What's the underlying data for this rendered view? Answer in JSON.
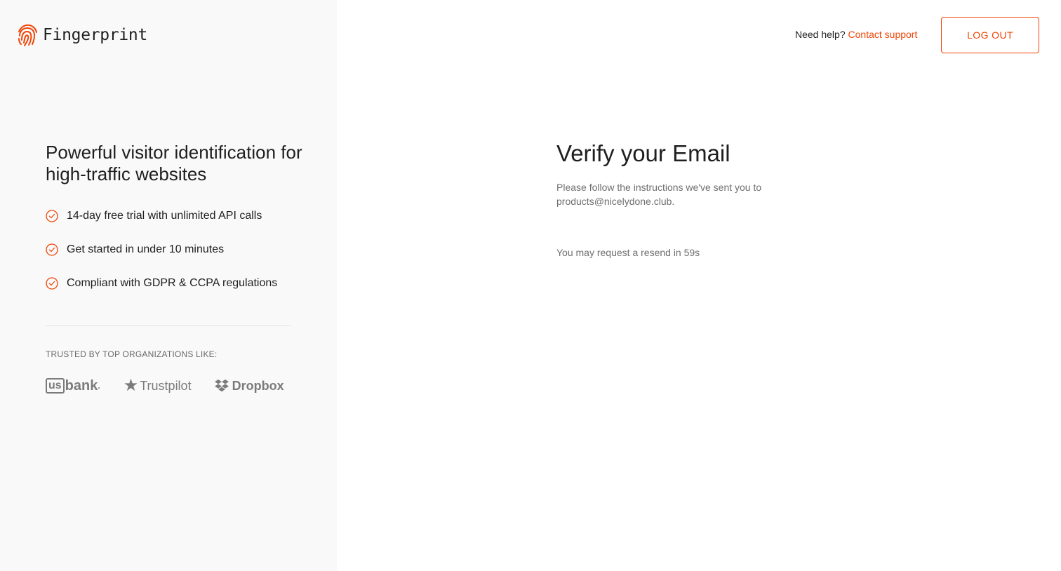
{
  "brand": {
    "name": "Fingerprint",
    "accent_color": "#f04405",
    "logo_icon": "fingerprint-icon"
  },
  "left": {
    "headline": "Powerful visitor identification for high-traffic websites",
    "features": [
      {
        "label": "14-day free trial with unlimited API calls",
        "icon": "check-circle-icon"
      },
      {
        "label": "Get started in under 10 minutes",
        "icon": "check-circle-icon"
      },
      {
        "label": "Compliant with GDPR & CCPA regulations",
        "icon": "check-circle-icon"
      }
    ],
    "trusted_label": "TRUSTED BY TOP ORGANIZATIONS LIKE:",
    "logos": {
      "usbank_us": "us",
      "usbank_bank": "bank",
      "usbank_dot": ".",
      "trustpilot": "Trustpilot",
      "dropbox": "Dropbox"
    }
  },
  "header": {
    "help_text": "Need help?",
    "help_link": "Contact support",
    "logout_label": "LOG OUT"
  },
  "main": {
    "title": "Verify your Email",
    "instructions": "Please follow the instructions we've sent you to products@nicelydone.club.",
    "resend_text": "You may request a resend in 59s"
  }
}
